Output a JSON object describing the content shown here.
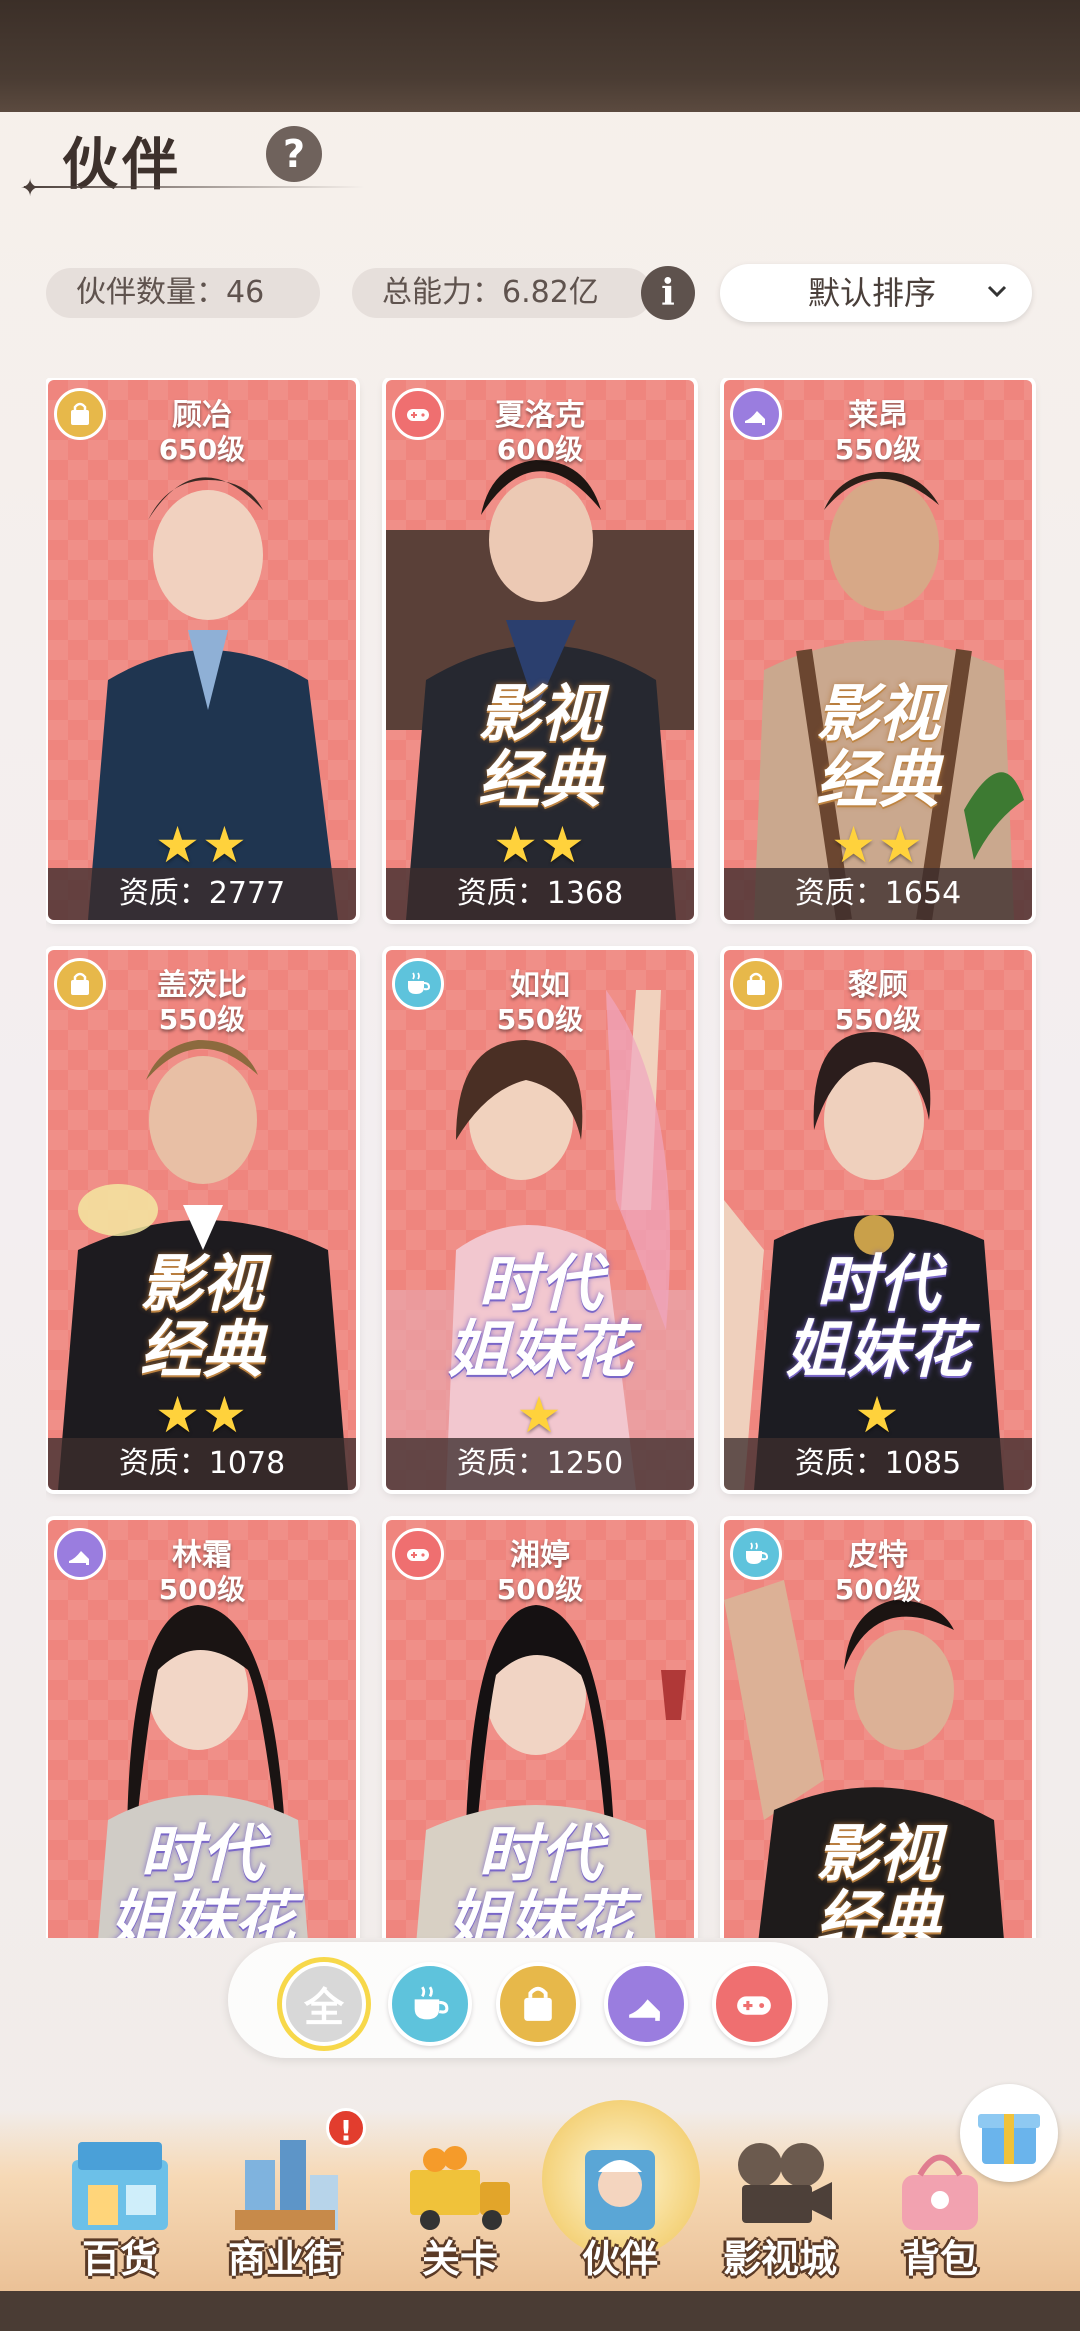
{
  "header": {
    "title": "伙伴",
    "help_label": "?"
  },
  "stats": {
    "partner_count": "伙伴数量：46",
    "total_power": "总能力：6.82亿",
    "info_label": "i",
    "sort_value": "默认排序"
  },
  "cards": [
    {
      "name": "顾冶",
      "level": "650级",
      "stars": "★★",
      "quality": "资质：2777",
      "type": "bag-icon",
      "tag": ""
    },
    {
      "name": "夏洛克",
      "level": "600级",
      "stars": "★★",
      "quality": "资质：1368",
      "type": "gamepad-icon",
      "tag_line1": "影视",
      "tag_line2": "经典"
    },
    {
      "name": "莱昂",
      "level": "550级",
      "stars": "★★",
      "quality": "资质：1654",
      "type": "heel-icon",
      "tag_line1": "影视",
      "tag_line2": "经典"
    },
    {
      "name": "盖茨比",
      "level": "550级",
      "stars": "★★",
      "quality": "资质：1078",
      "type": "bag-icon",
      "tag_line1": "影视",
      "tag_line2": "经典"
    },
    {
      "name": "如如",
      "level": "550级",
      "stars": "★",
      "quality": "资质：1250",
      "type": "cup-icon",
      "tag_line1": "时代",
      "tag_line2": "姐妹花"
    },
    {
      "name": "黎顾",
      "level": "550级",
      "stars": "★",
      "quality": "资质：1085",
      "type": "bag-icon",
      "tag_line1": "时代",
      "tag_line2": "姐妹花"
    },
    {
      "name": "林霜",
      "level": "500级",
      "type": "heel-icon",
      "tag_line1": "时代",
      "tag_line2": "姐妹花"
    },
    {
      "name": "湘婷",
      "level": "500级",
      "type": "gamepad-icon",
      "tag_line1": "时代",
      "tag_line2": "姐妹花"
    },
    {
      "name": "皮特",
      "level": "500级",
      "type": "cup-icon",
      "tag_line1": "影视",
      "tag_line2": "经典"
    }
  ],
  "filters": {
    "all_label": "全",
    "icons": [
      "cup-icon",
      "bag-icon",
      "heel-icon",
      "gamepad-icon"
    ]
  },
  "nav": {
    "items": [
      "百货",
      "商业街",
      "关卡",
      "伙伴",
      "影视城",
      "背包"
    ],
    "alert": "!"
  },
  "colors": {
    "card_bg": "#ef857e",
    "badge_bag": "#e7b84a",
    "badge_gamepad": "#ef6f70",
    "badge_heel": "#9a7ddf",
    "badge_cup": "#5ec3dc"
  }
}
